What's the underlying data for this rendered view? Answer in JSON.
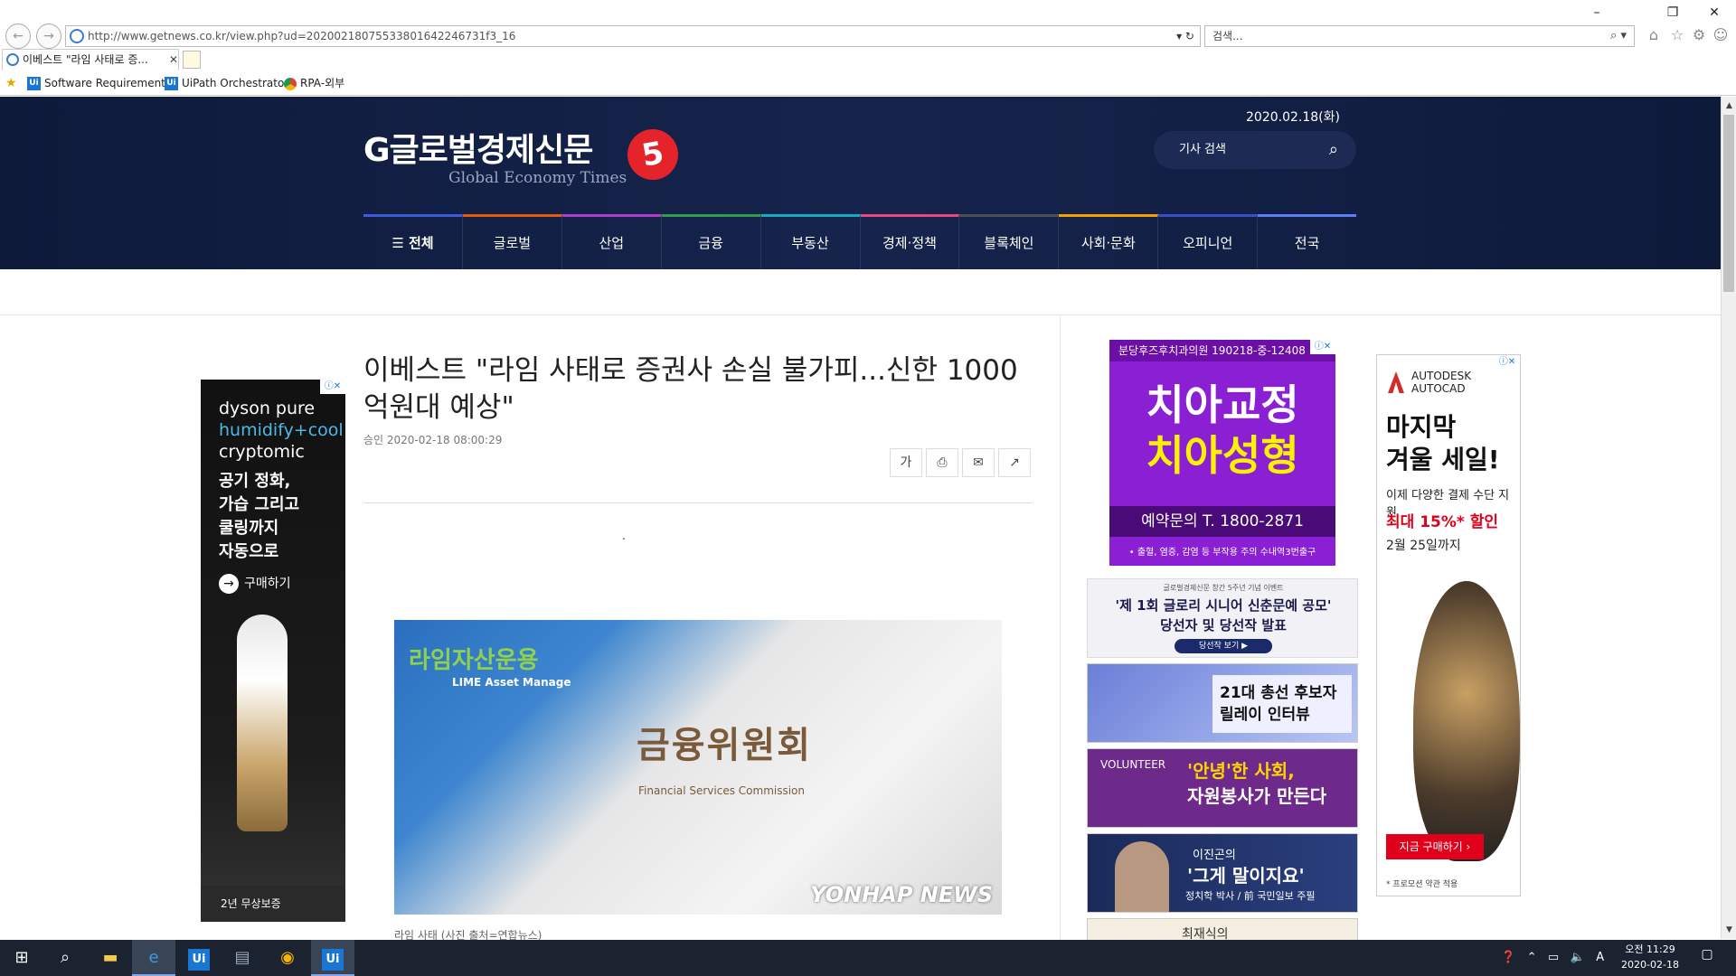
{
  "browser": {
    "url": "http://www.getnews.co.kr/view.php?ud=202002180755338016422467​31f3_16",
    "search_placeholder": "검색...",
    "tab_title": "이베스트 \"라임 사태로 증...",
    "favorites": [
      "Software Requirements",
      "UiPath Orchestrator",
      "RPA-외부"
    ]
  },
  "site": {
    "logo": "G글로벌경제신문",
    "logo_sub": "Global Economy Times",
    "anniversary": "5",
    "date": "2020.02.18(화)",
    "search_placeholder": "기사 검색",
    "menu": [
      "☰ 전체",
      "글로벌",
      "산업",
      "금융",
      "부동산",
      "경제·정책",
      "블록체인",
      "사회·문화",
      "오피니언",
      "전국"
    ]
  },
  "article": {
    "title": "이베스트 \"라임 사태로 증권사 손실 불가피...신한 1000억원대 예상\"",
    "byline": "승인 2020-02-18 08:00:29",
    "tools": [
      "가",
      "⎙",
      "✉",
      "↗"
    ],
    "dot": ".",
    "photo": {
      "lime": "라임자산운용",
      "lime_en": "LIME Asset Manage",
      "fsc": "금융위원회",
      "fsc_en": "Financial Services Commission",
      "watermark": "YONHAP NEWS"
    },
    "caption": "라임 사태 (사진 출처=연합뉴스)"
  },
  "ads": {
    "dyson": {
      "brand1": "dyson pure",
      "brand2": "humidify+cool",
      "brand3": "cryptomic",
      "copy": [
        "공기 정화,",
        "가습 그리고",
        "쿨링까지",
        "자동으로"
      ],
      "buy": "구매하기",
      "warranty": "2년 무상보증"
    },
    "dental": {
      "top": "분당후즈후치과의원  190218-중-12408",
      "line1": "치아교정",
      "line2": "치아성형",
      "tel": "예약문의  T. 1800-2871",
      "foot": "• 출혈, 염증, 감염 등 부작용 주의    수내역3번출구"
    },
    "banner1": {
      "small": "글로벌경제신문 창간 5주년 기념 이벤트",
      "l1": "'제 1회 글로리 시니어 신춘문예 공모'",
      "l2": "당선자 및 당선작 발표",
      "btn": "당선작 보기 ▶"
    },
    "banner2": {
      "text": "21대 총선 후보자 릴레이 인터뷰"
    },
    "banner3": {
      "vol": "VOLUNTEER",
      "t1": "'안녕'한 사회,",
      "t2": "자원봉사가 만든다"
    },
    "banner4": {
      "name": "이진곤의",
      "quote": "'그게 말이지요'",
      "sub": "정치학 박사 / 前 국민일보 주필"
    },
    "banner5": {
      "name": "최재식의"
    },
    "autodesk": {
      "brand1": "AUTODESK",
      "brand2": "AUTOCAD",
      "h1": "마지막",
      "h2": "겨울 세일!",
      "desc": "이제 다양한 결제 수단 지원",
      "promo": "최대 15%* 할인",
      "date": "2월 25일까지",
      "cta": "지금 구매하기 ›",
      "fine": "* 프로모션 약관 적용"
    }
  },
  "taskbar": {
    "time": "오전 11:29",
    "date": "2020-02-18",
    "ime": "A"
  }
}
